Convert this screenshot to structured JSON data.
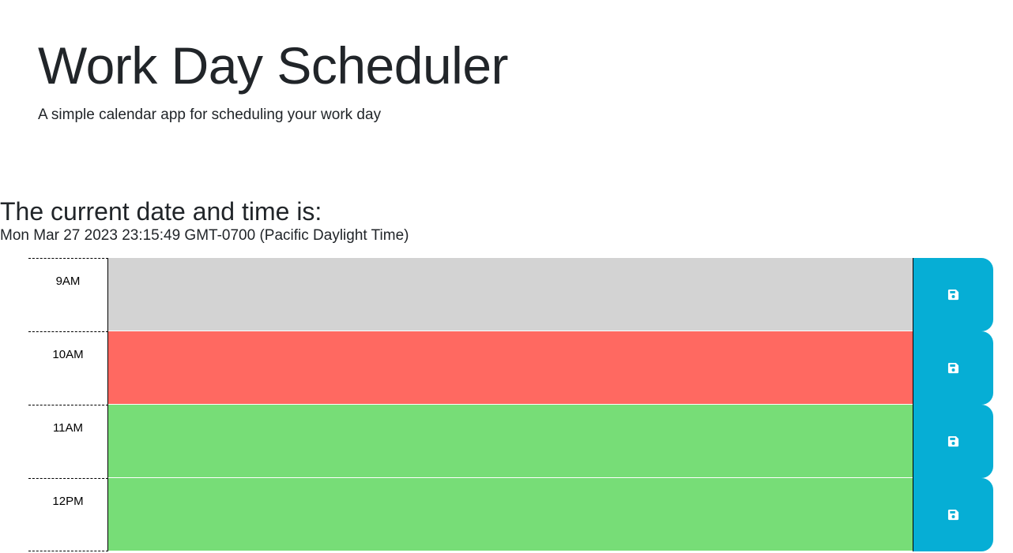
{
  "header": {
    "title": "Work Day Scheduler",
    "lead": "A simple calendar app for scheduling your work day"
  },
  "now": {
    "heading": "The current date and time is:",
    "value": "Mon Mar 27 2023 23:15:49 GMT-0700 (Pacific Daylight Time)"
  },
  "colors": {
    "past": "#d3d3d3",
    "present": "#ff6961",
    "future": "#77dd77",
    "save_button": "#06aed5"
  },
  "schedule": {
    "rows": [
      {
        "hour": "9AM",
        "status": "past",
        "text": "",
        "save_icon": "floppy-disk-icon"
      },
      {
        "hour": "10AM",
        "status": "present",
        "text": "",
        "save_icon": "floppy-disk-icon"
      },
      {
        "hour": "11AM",
        "status": "future",
        "text": "",
        "save_icon": "floppy-disk-icon"
      },
      {
        "hour": "12PM",
        "status": "future",
        "text": "",
        "save_icon": "floppy-disk-icon"
      }
    ]
  }
}
